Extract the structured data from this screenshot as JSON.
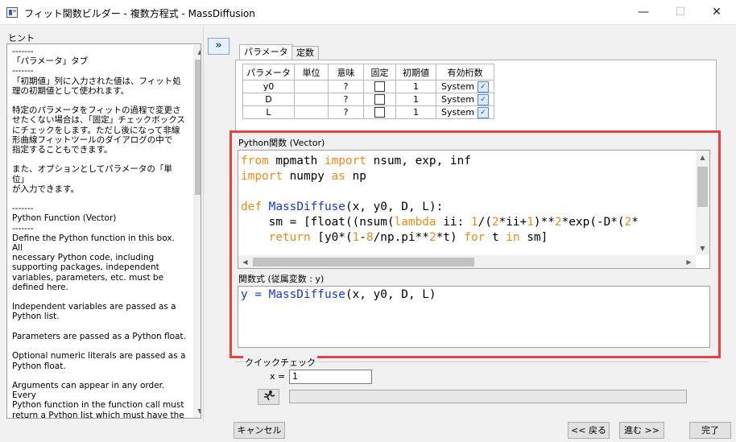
{
  "window": {
    "title": "フィット関数ビルダー - 複数方程式 - MassDiffusion",
    "minimize": "—",
    "maximize": "☐",
    "close": "✕"
  },
  "hint": {
    "label": "ヒント",
    "text": "-------\n「パラメータ」タブ\n-------\n「初期値」列に入力された値は、フィット処\n理の初期値として使われます。\n\n特定のパラメータをフィットの過程で変更さ\nせたくない場合は、「固定」チェックボックス\nにチェックをします。ただし後になって非線\n形曲線フィットツールのダイアログの中で\n指定することもできます。\n\nまた、オプションとしてパラメータの「単位」\nが入力できます。\n\n-------\nPython Function (Vector)\n-------\nDefine the Python function in this box. All\nnecessary Python code, including\nsupporting packages, independent\nvariables, parameters, etc. must be\ndefined here.\n\nIndependent variables are passed as a\nPython list.\n\nParameters are passed as a Python float.\n\nOptional numeric literals are passed as a\nPython float.\n\nArguments can appear in any order. Every\nPython function in the function call must\nreturn a Python list which must have the\nsame size as the input Python list(s) of\nindependent variables\n\nVector Python function is faster than"
  },
  "expand_label": "»",
  "tabs": [
    {
      "label": "パラメータ",
      "active": true
    },
    {
      "label": "定数",
      "active": false
    }
  ],
  "param_table": {
    "headers": [
      "パラメータ",
      "単位",
      "意味",
      "固定",
      "初期値",
      "有効桁数"
    ],
    "rows": [
      {
        "name": "y0",
        "unit": "",
        "meaning": "?",
        "fixed": false,
        "init": "1",
        "sig": "System"
      },
      {
        "name": "D",
        "unit": "",
        "meaning": "?",
        "fixed": false,
        "init": "1",
        "sig": "System"
      },
      {
        "name": "L",
        "unit": "",
        "meaning": "?",
        "fixed": false,
        "init": "1",
        "sig": "System"
      }
    ]
  },
  "python_label": "Python関数 (Vector)",
  "code": {
    "line1": {
      "a": "from",
      "b": " mpmath ",
      "c": "import",
      "d": " nsum, exp, inf"
    },
    "line2": {
      "a": "import",
      "b": " numpy ",
      "c": "as",
      "d": " np"
    },
    "line4": {
      "a": "def",
      "b": " ",
      "c": "MassDiffuse",
      "d": "(x, y0, D, L):"
    },
    "line5": {
      "a": "    sm = [float((nsum(",
      "b": "lambda",
      "c": " ii: ",
      "d": "1",
      "e": "/(",
      "f": "2",
      "g": "*ii+",
      "h": "1",
      "i": ")**",
      "j": "2",
      "k": "*exp(-D*(",
      "l": "2",
      "m": "*"
    },
    "line6": {
      "a": "    ",
      "b": "return",
      "c": " [y0*(",
      "d": "1",
      "e": "-",
      "f": "8",
      "g": "/np.pi**",
      "h": "2",
      "i": "*t) ",
      "j": "for",
      "k": " t ",
      "l": "in",
      "m": " sm]"
    }
  },
  "func_label": "関数式 (従属変数 : y)",
  "func_expr": {
    "a": "y = ",
    "b": "MassDiffuse",
    "c": "(x, y0, D, L)"
  },
  "quick_check": {
    "label": "クイックチェック",
    "x_label": "x =",
    "x_value": "1",
    "run_icon": "run-icon",
    "result": ""
  },
  "buttons": {
    "cancel": "キャンセル",
    "back": "<< 戻る",
    "next": "進む >>",
    "finish": "完了"
  },
  "colors": {
    "keyword": "#f08a1a",
    "function": "#1638d8",
    "highlight": "#e04444"
  }
}
